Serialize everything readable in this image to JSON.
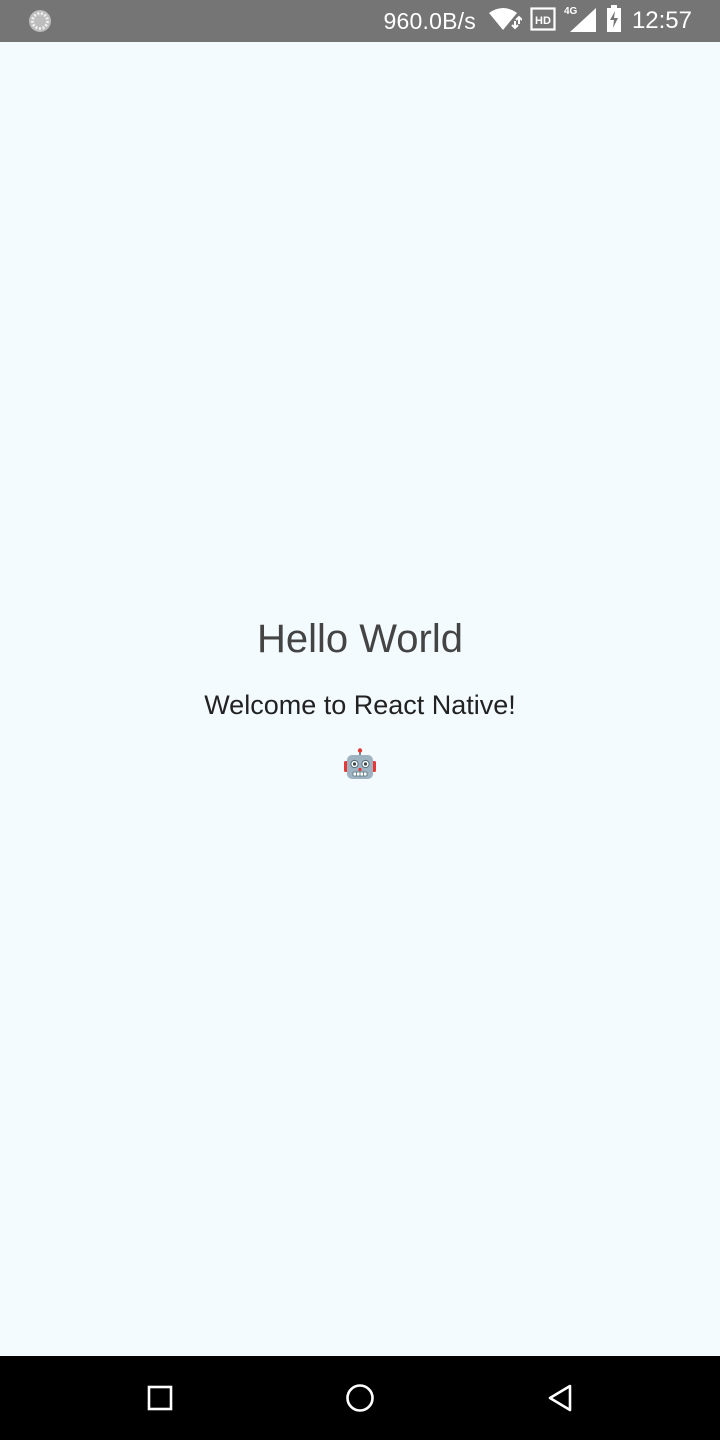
{
  "status_bar": {
    "network_speed": "960.0B/s",
    "hd_badge": "HD",
    "network_type": "4G",
    "time": "12:57",
    "left_icon": "sync-indicator-icon",
    "icons": [
      "wifi-icon",
      "hd-icon",
      "signal-4g-icon",
      "battery-charging-icon"
    ]
  },
  "main": {
    "title": "Hello World",
    "subtitle": "Welcome to React Native!",
    "emoji_icon": "robot-icon"
  },
  "nav_bar": {
    "buttons": [
      "recents-icon",
      "home-icon",
      "back-icon"
    ]
  },
  "colors": {
    "background": "#f4fbfe",
    "status_bar": "#757575",
    "nav_bar": "#000000",
    "title_text": "#444444",
    "subtitle_text": "#222222"
  }
}
